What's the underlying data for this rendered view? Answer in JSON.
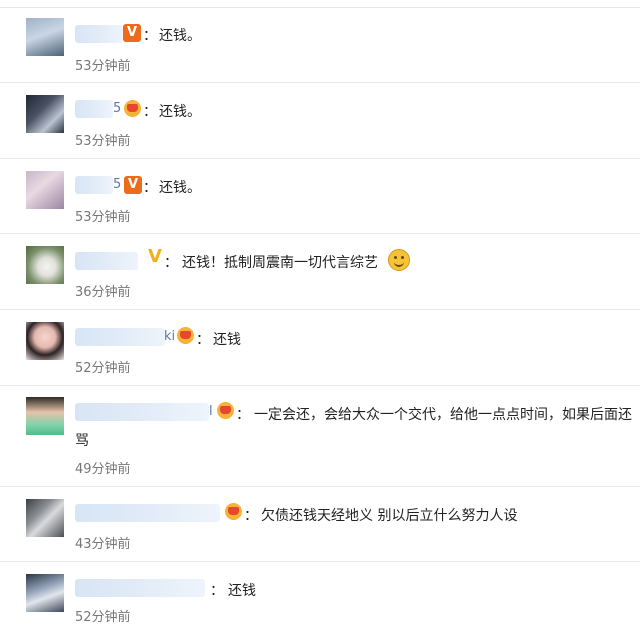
{
  "comments": [
    {
      "colon": "：",
      "text": "还钱。",
      "time": "53分钟前",
      "name_tail": ""
    },
    {
      "colon": "：",
      "text": "还钱。",
      "time": "53分钟前",
      "name_tail": "5"
    },
    {
      "colon": "：",
      "text": "还钱。",
      "time": "53分钟前",
      "name_tail": "5"
    },
    {
      "colon": "：",
      "text": "还钱！抵制周震南一切代言综艺",
      "time": "36分钟前",
      "name_tail": ""
    },
    {
      "colon": "：",
      "text": "还钱",
      "time": "52分钟前",
      "name_tail": "ki"
    },
    {
      "colon": "：",
      "text": "一定会还，会给大众一个交代，给他一点点时间，如果后面还",
      "text2": "骂",
      "time": "49分钟前",
      "name_tail": "l"
    },
    {
      "colon": "：",
      "text": "欠债还钱天经地义 别以后立什么努力人设",
      "time": "43分钟前",
      "name_tail": ""
    },
    {
      "colon": "：",
      "text": "还钱",
      "time": "52分钟前",
      "name_tail": ""
    }
  ],
  "icons": {
    "badge_v": "verified-orange-v-icon",
    "badge_v_gold": "verified-gold-v-icon",
    "badge_crown": "vip-crown-icon",
    "emoji": "smiley-emoji-icon"
  }
}
